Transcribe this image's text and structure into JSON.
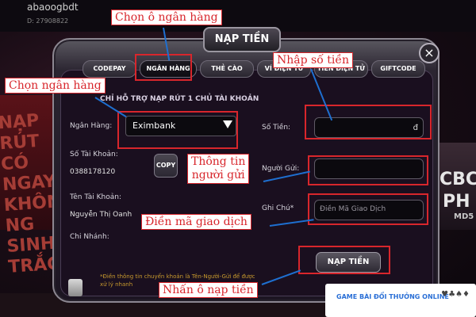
{
  "background": {
    "username": "abaoogbdt",
    "user_id": "D: 27908822",
    "promo_left": "NẠP RÚT\nCÓ NGAY\nKHÔNG NG\nSINH TRẮC",
    "promo_right_line1": "CBC",
    "promo_right_line2": "PH",
    "promo_right_md5": "MD5"
  },
  "dialog": {
    "title": "NẠP TIỀN",
    "close_glyph": "×",
    "tabs": [
      {
        "label": "CODEPAY",
        "active": false
      },
      {
        "label": "NGÂN HÀNG",
        "active": true
      },
      {
        "label": "THẺ CÀO",
        "active": false
      },
      {
        "label": "VÍ ĐIỆN TỬ",
        "active": false
      },
      {
        "label": "TIỀN ĐIỆN TỬ",
        "active": false
      },
      {
        "label": "GIFTCODE",
        "active": false
      }
    ],
    "notice": "CHỈ HỖ TRỢ NẠP RÚT 1 CHỦ TÀI KHOẢN",
    "bank_label": "Ngân Hàng:",
    "bank_value": "Eximbank",
    "account_number_label": "Số Tài Khoản:",
    "account_number_value": "0388178120",
    "copy_label": "COPY",
    "account_name_label": "Tên Tài Khoản:",
    "account_name_value": "Nguyễn Thị Oanh",
    "branch_label": "Chi Nhánh:",
    "amount_label": "Số Tiền:",
    "amount_suffix": "đ",
    "sender_label": "Người Gửi:",
    "note_label": "Ghi Chú*",
    "note_placeholder": "Điền Mã Giao Dịch",
    "submit_label": "NẠP TIỀN",
    "footnote": "*Điền thông tin chuyển khoản là Tên-Người-Gửi để được xử lý nhanh"
  },
  "annotations": {
    "choose_bank_tab": "Chọn ô ngân hàng",
    "choose_bank": "Chọn ngân hàng",
    "enter_amount": "Nhập số tiền",
    "sender_info_line1": "Thông tin",
    "sender_info_line2": "người gửi",
    "enter_code": "Điền mã giao dịch",
    "press_submit": "Nhấn ô nạp tiền"
  },
  "watermark": {
    "text": "GAME BÀI ĐỔI THƯỞNG ONLINE",
    "cards": "♥♣♠♦"
  },
  "colors": {
    "annotation_red": "#d8262c",
    "annotation_blue": "#1e6fd0",
    "footnote_gold": "#c89a2e"
  }
}
